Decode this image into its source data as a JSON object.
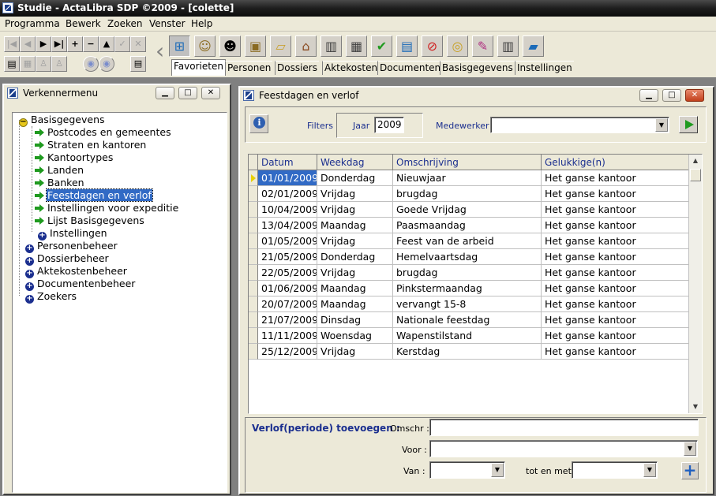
{
  "window_title": "Studie - ActaLibra  SDP ©2009 - [colette]",
  "menu": [
    "Programma",
    "Bewerk",
    "Zoeken",
    "Venster",
    "Help"
  ],
  "nav_buttons": {
    "first": "|◀",
    "prev": "◀",
    "next": "▶",
    "last": "▶|",
    "add": "+",
    "remove": "−",
    "up": "▲",
    "check": "✓",
    "cancel": "✕"
  },
  "toolbar_icons": [
    "tree-structure-icon",
    "person-badge-icon",
    "user-face-icon",
    "dossier-icon",
    "open-folder-icon",
    "home-icon",
    "building-icon",
    "calculator-icon",
    "checklist-icon",
    "document-person-icon",
    "no-entry-icon",
    "coins-icon",
    "note-pencil-icon",
    "building-search-icon",
    "book-icon"
  ],
  "tabs": [
    "Favorieten",
    "Personen",
    "Dossiers",
    "Aktekosten",
    "Documenten",
    "Basisgegevens",
    "Instellingen"
  ],
  "left_window": {
    "title": "Verkennermenu",
    "tree": [
      {
        "label": "Basisgegevens",
        "icon": "minus",
        "level": 0
      },
      {
        "label": "Postcodes en gemeentes",
        "icon": "arrow",
        "level": 1
      },
      {
        "label": "Straten en kantoren",
        "icon": "arrow",
        "level": 1
      },
      {
        "label": "Kantoortypes",
        "icon": "arrow",
        "level": 1
      },
      {
        "label": "Landen",
        "icon": "arrow",
        "level": 1
      },
      {
        "label": "Banken",
        "icon": "arrow",
        "level": 1
      },
      {
        "label": "Feestdagen en verlof",
        "icon": "arrow",
        "level": 1,
        "selected": true
      },
      {
        "label": "Instellingen voor expeditie",
        "icon": "arrow",
        "level": 1
      },
      {
        "label": "Lijst Basisgegevens",
        "icon": "arrow",
        "level": 1
      },
      {
        "label": "Instellingen",
        "icon": "plus",
        "level": 1
      },
      {
        "label": "Personenbeheer",
        "icon": "plus",
        "level": 0
      },
      {
        "label": "Dossierbeheer",
        "icon": "plus",
        "level": 0
      },
      {
        "label": "Aktekostenbeheer",
        "icon": "plus",
        "level": 0
      },
      {
        "label": "Documentenbeheer",
        "icon": "plus",
        "level": 0
      },
      {
        "label": "Zoekers",
        "icon": "plus",
        "level": 0
      }
    ]
  },
  "right_window": {
    "title": "Feestdagen en verlof",
    "filters_label": "Filters",
    "jaar_label": "Jaar",
    "jaar_value": "2009",
    "medewerker_label": "Medewerker",
    "medewerker_value": "",
    "grid": {
      "columns": [
        "Datum",
        "Weekdag",
        "Omschrijving",
        "Gelukkige(n)"
      ],
      "rows": [
        [
          "01/01/2009",
          "Donderdag",
          "Nieuwjaar",
          "Het ganse kantoor"
        ],
        [
          "02/01/2009",
          "Vrijdag",
          "brugdag",
          "Het ganse kantoor"
        ],
        [
          "10/04/2009",
          "Vrijdag",
          "Goede Vrijdag",
          "Het ganse kantoor"
        ],
        [
          "13/04/2009",
          "Maandag",
          "Paasmaandag",
          "Het ganse kantoor"
        ],
        [
          "01/05/2009",
          "Vrijdag",
          "Feest van de arbeid",
          "Het ganse kantoor"
        ],
        [
          "21/05/2009",
          "Donderdag",
          "Hemelvaartsdag",
          "Het ganse kantoor"
        ],
        [
          "22/05/2009",
          "Vrijdag",
          "brugdag",
          "Het ganse kantoor"
        ],
        [
          "01/06/2009",
          "Maandag",
          "Pinkstermaandag",
          "Het ganse kantoor"
        ],
        [
          "20/07/2009",
          "Maandag",
          "vervangt 15-8",
          "Het ganse kantoor"
        ],
        [
          "21/07/2009",
          "Dinsdag",
          "Nationale feestdag",
          "Het ganse kantoor"
        ],
        [
          "11/11/2009",
          "Woensdag",
          "Wapenstilstand",
          "Het ganse kantoor"
        ],
        [
          "25/12/2009",
          "Vrijdag",
          "Kerstdag",
          "Het ganse kantoor"
        ]
      ]
    },
    "add_section": {
      "heading": "Verlof(periode) toevoegen :",
      "omschr_label": "Omschr :",
      "omschr_value": "",
      "voor_label": "Voor :",
      "voor_value": "",
      "van_label": "Van :",
      "van_value": "",
      "tot_label": "tot en met",
      "tot_value": ""
    }
  },
  "colors": {
    "selection": "#316ac5",
    "label_blue": "#1b2f8f",
    "green": "#1f9a1f"
  }
}
